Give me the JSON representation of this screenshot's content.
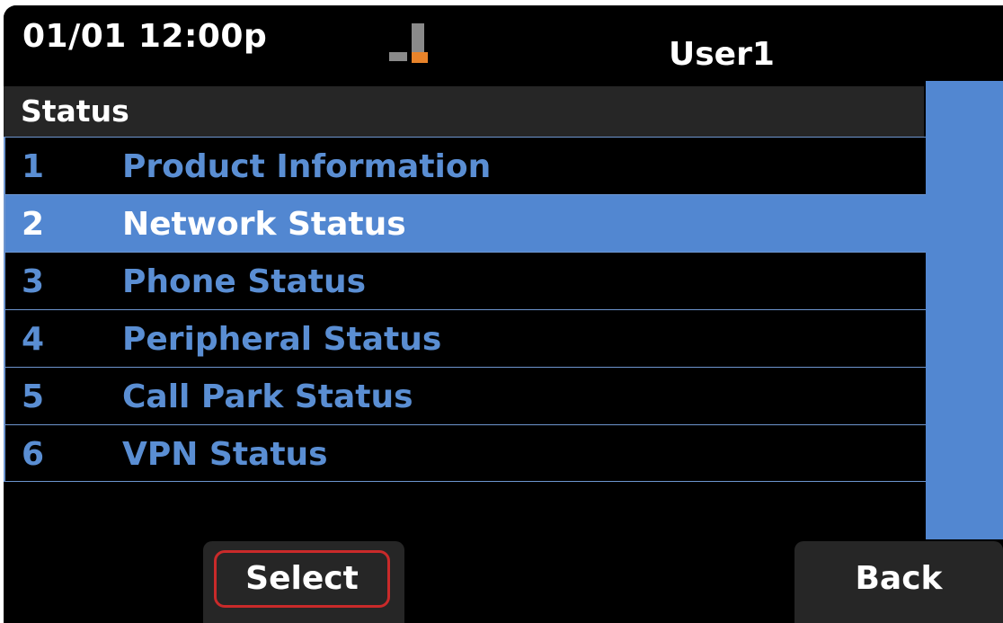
{
  "statusbar": {
    "datetime": "01/01 12:00p",
    "user": "User1",
    "network_icon": "network-status-icon"
  },
  "menu": {
    "title": "Status",
    "selected_index": 1,
    "items": [
      {
        "num": "1",
        "label": "Product Information"
      },
      {
        "num": "2",
        "label": "Network Status"
      },
      {
        "num": "3",
        "label": "Phone Status"
      },
      {
        "num": "4",
        "label": "Peripheral Status"
      },
      {
        "num": "5",
        "label": "Call Park Status"
      },
      {
        "num": "6",
        "label": "VPN Status"
      }
    ]
  },
  "softkeys": {
    "select": "Select",
    "back": "Back"
  },
  "colors": {
    "accent": "#5287d1",
    "item_text": "#5a8ed3",
    "focus_ring": "#c92a2a",
    "network_active": "#e8832a"
  }
}
